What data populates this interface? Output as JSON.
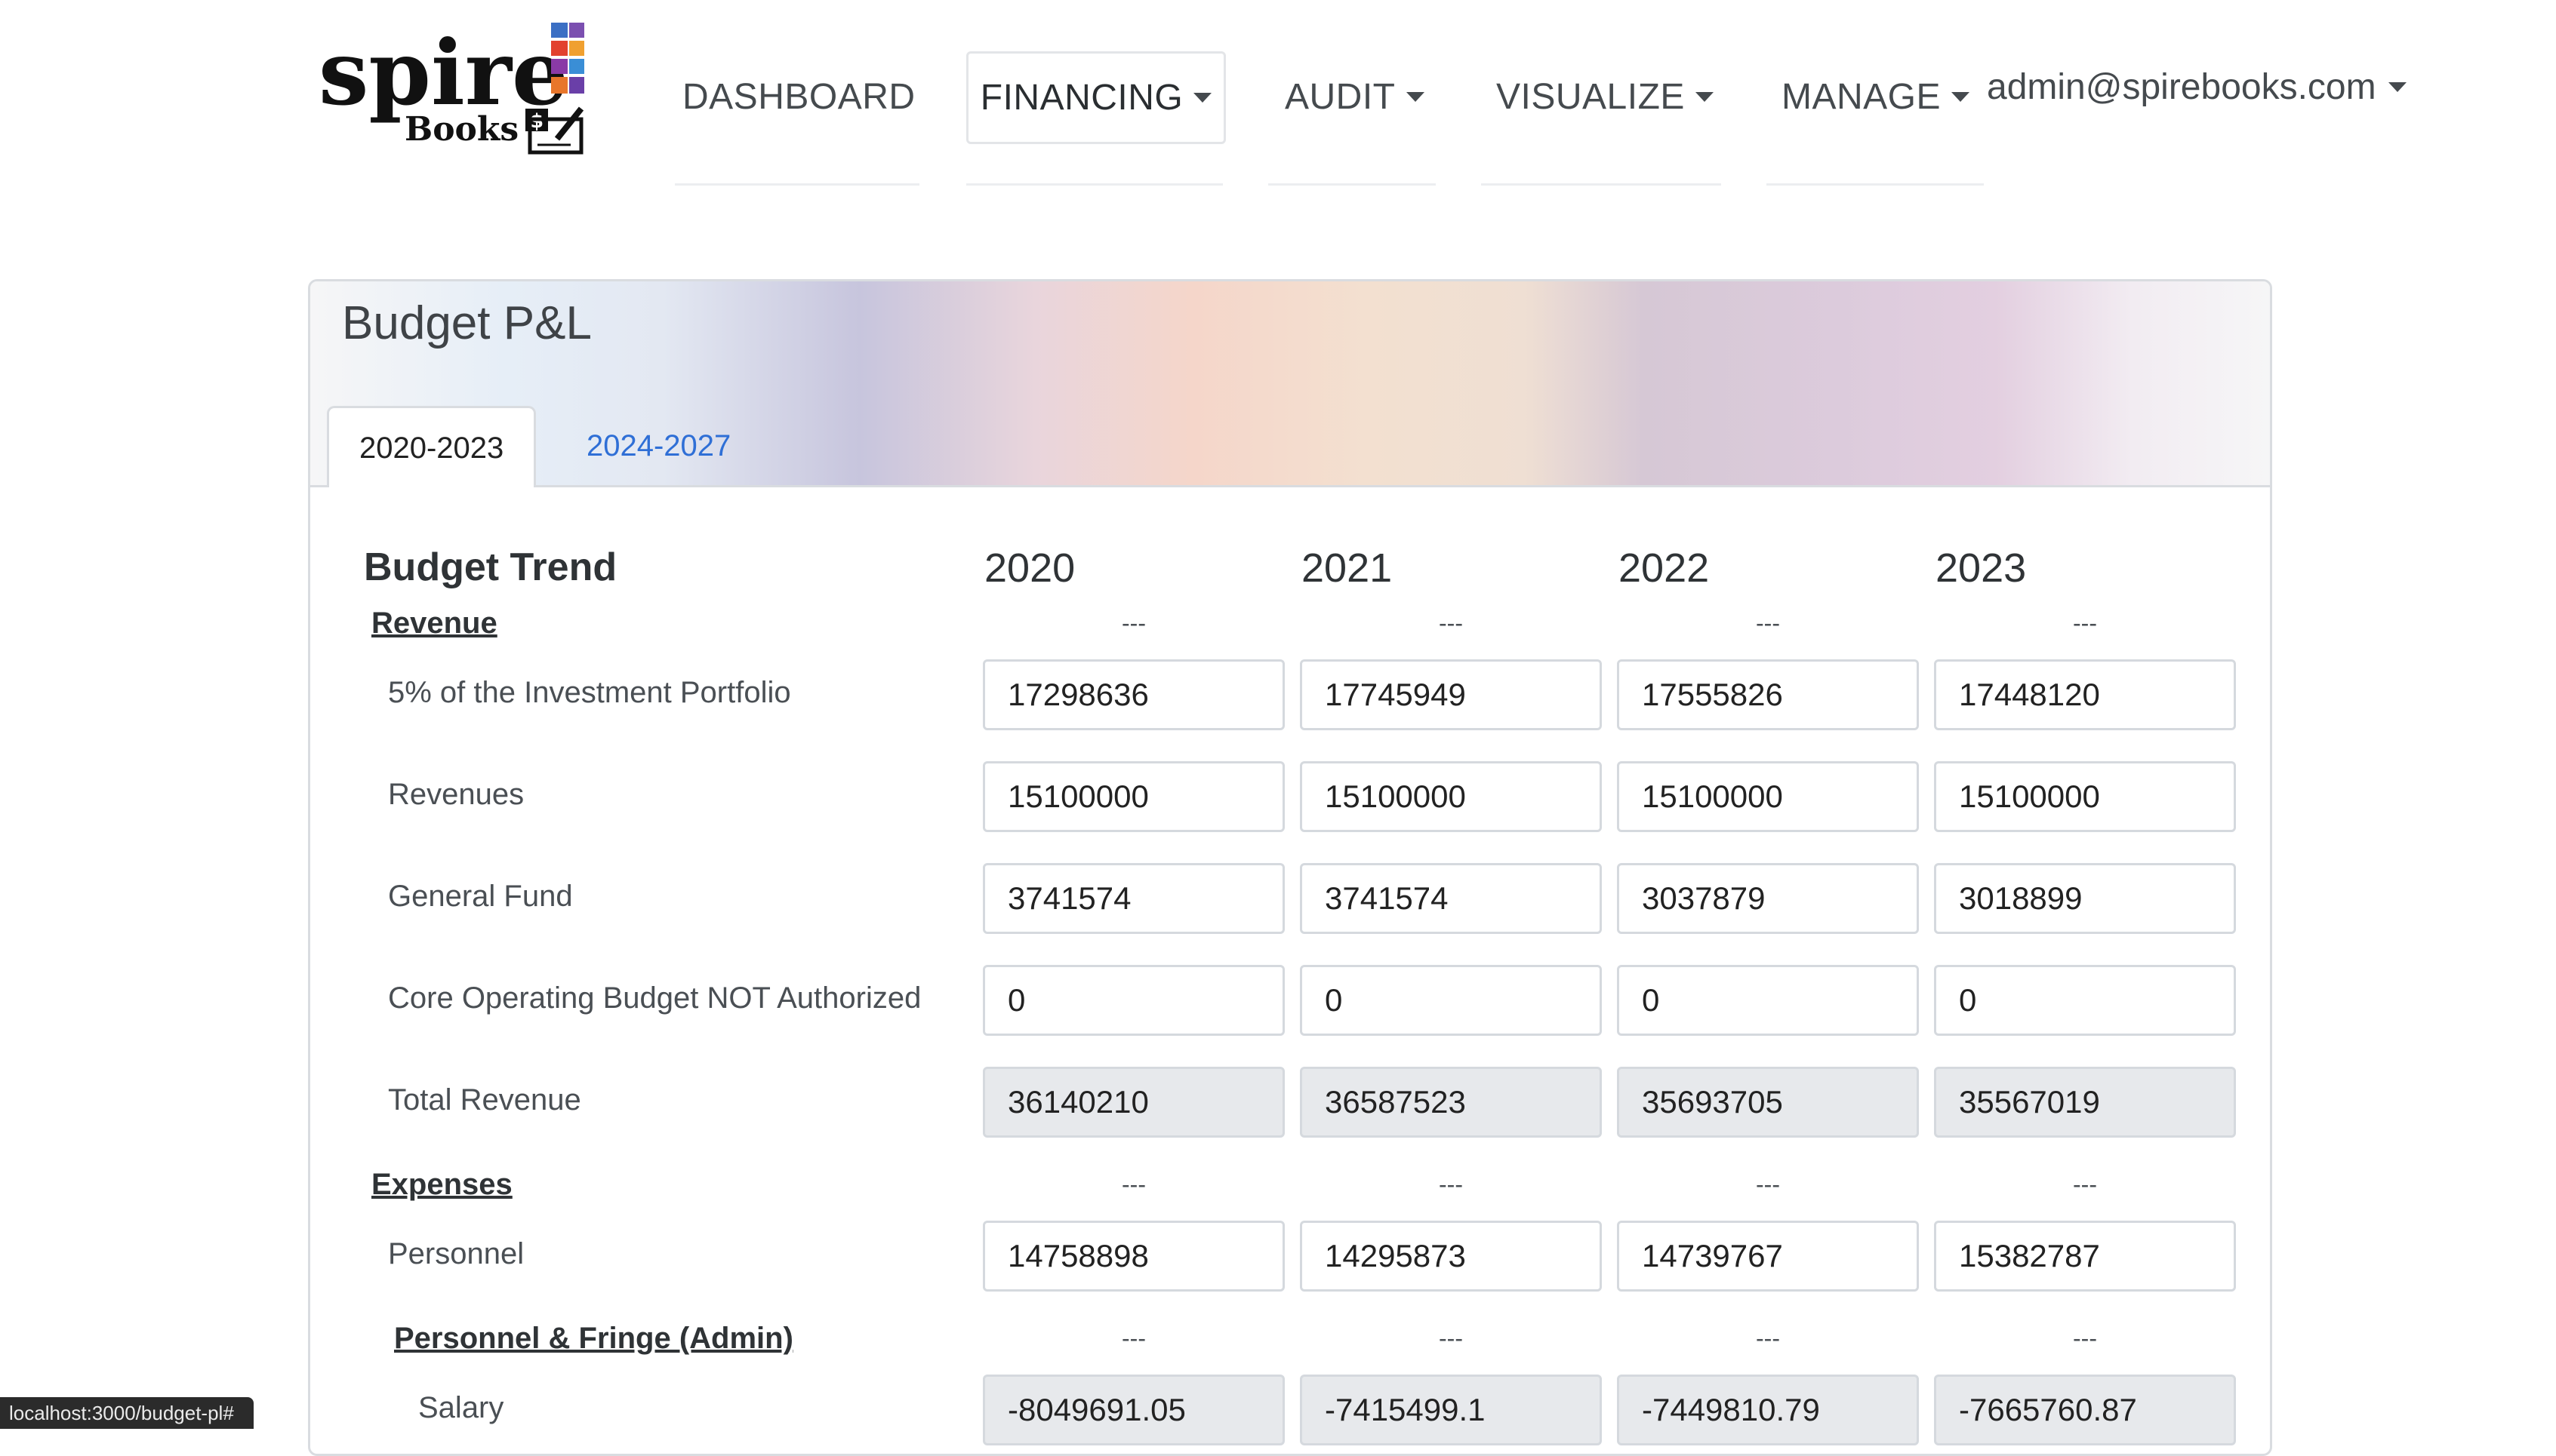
{
  "brand": {
    "name": "spire",
    "sub": "Books",
    "dollar": "$"
  },
  "nav": {
    "items": [
      {
        "label": "DASHBOARD"
      },
      {
        "label": "FINANCING"
      },
      {
        "label": "AUDIT"
      },
      {
        "label": "VISUALIZE"
      },
      {
        "label": "MANAGE"
      }
    ],
    "user": "admin@spirebooks.com"
  },
  "card": {
    "title": "Budget P&L",
    "tabs": [
      {
        "label": "2020-2023"
      },
      {
        "label": "2024-2027"
      }
    ]
  },
  "table": {
    "title": "Budget Trend",
    "years": [
      "2020",
      "2021",
      "2022",
      "2023"
    ],
    "dash": "---",
    "sections": {
      "revenue": "Revenue",
      "expenses": "Expenses",
      "personnel_fringe": "Personnel & Fringe (Admin)"
    },
    "rows": {
      "investment": {
        "label": "5% of the Investment Portfolio",
        "values": [
          "17298636",
          "17745949",
          "17555826",
          "17448120"
        ]
      },
      "revenues": {
        "label": "Revenues",
        "values": [
          "15100000",
          "15100000",
          "15100000",
          "15100000"
        ]
      },
      "general_fund": {
        "label": "General Fund",
        "values": [
          "3741574",
          "3741574",
          "3037879",
          "3018899"
        ]
      },
      "core_operating": {
        "label": "Core Operating Budget NOT Authorized",
        "values": [
          "0",
          "0",
          "0",
          "0"
        ]
      },
      "total_revenue": {
        "label": "Total Revenue",
        "values": [
          "36140210",
          "36587523",
          "35693705",
          "35567019"
        ]
      },
      "personnel": {
        "label": "Personnel",
        "values": [
          "14758898",
          "14295873",
          "14739767",
          "15382787"
        ]
      },
      "salary": {
        "label": "Salary",
        "values": [
          "-8049691.05",
          "-7415499.1",
          "-7449810.79",
          "-7665760.87"
        ]
      }
    }
  },
  "status_url": "localhost:3000/budget-pl#"
}
